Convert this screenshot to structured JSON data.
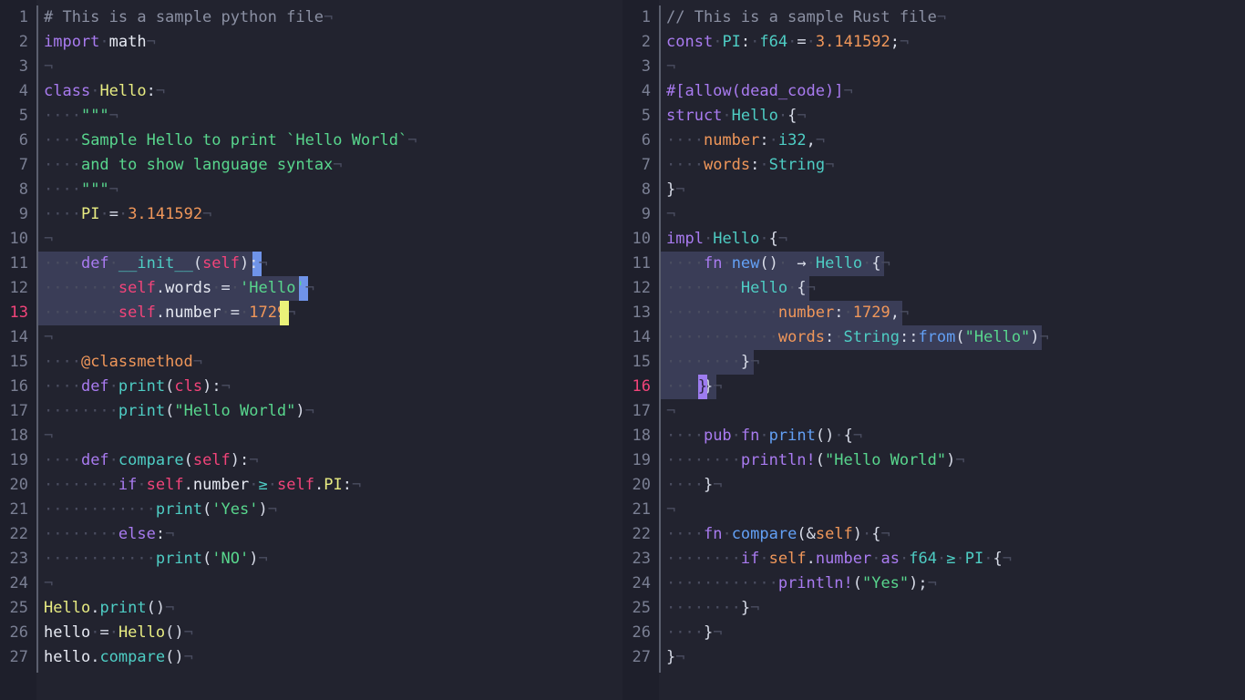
{
  "app": {
    "kind": "code-editor",
    "theme": "dark",
    "background": "#22232f",
    "gutter_background": "#1e1f2b",
    "gutter_separator": "#5b5f6e",
    "selection": "#3a3d57",
    "active_line_number": "#f2447a",
    "line_number": "#7a7f93",
    "whitespace_marker": "·",
    "eol_marker": "¬"
  },
  "panes": [
    {
      "name": "python-pane",
      "language": "python",
      "active_line": 13,
      "caret_color": "#eaf279",
      "eol_select_color": "#6f93e8",
      "first_line": 1,
      "last_line": 27,
      "lines": [
        {
          "n": 1,
          "text": "# This is a sample python file"
        },
        {
          "n": 2,
          "text": "import math"
        },
        {
          "n": 3,
          "text": ""
        },
        {
          "n": 4,
          "text": "class Hello:"
        },
        {
          "n": 5,
          "text": "    \"\"\""
        },
        {
          "n": 6,
          "text": "    Sample Hello to print `Hello World`"
        },
        {
          "n": 7,
          "text": "    and to show language syntax"
        },
        {
          "n": 8,
          "text": "    \"\"\""
        },
        {
          "n": 9,
          "text": "    PI = 3.141592"
        },
        {
          "n": 10,
          "text": ""
        },
        {
          "n": 11,
          "text": "    def __init__(self):"
        },
        {
          "n": 12,
          "text": "        self.words = 'Hello'"
        },
        {
          "n": 13,
          "text": "        self.number = 1729"
        },
        {
          "n": 14,
          "text": ""
        },
        {
          "n": 15,
          "text": "    @classmethod"
        },
        {
          "n": 16,
          "text": "    def print(cls):"
        },
        {
          "n": 17,
          "text": "        print(\"Hello World\")"
        },
        {
          "n": 18,
          "text": ""
        },
        {
          "n": 19,
          "text": "    def compare(self):"
        },
        {
          "n": 20,
          "text": "        if self.number >= self.PI:"
        },
        {
          "n": 21,
          "text": "            print('Yes')"
        },
        {
          "n": 22,
          "text": "        else:"
        },
        {
          "n": 23,
          "text": "            print('NO')"
        },
        {
          "n": 24,
          "text": ""
        },
        {
          "n": 25,
          "text": "Hello.print()"
        },
        {
          "n": 26,
          "text": "hello = Hello()"
        },
        {
          "n": 27,
          "text": "hello.compare()"
        }
      ],
      "selected_lines": [
        11,
        12,
        13
      ]
    },
    {
      "name": "rust-pane",
      "language": "rust",
      "active_line": 16,
      "caret_color": "#9d7cf0",
      "first_line": 1,
      "last_line": 27,
      "lines": [
        {
          "n": 1,
          "text": "// This is a sample Rust file"
        },
        {
          "n": 2,
          "text": "const PI: f64 = 3.141592;"
        },
        {
          "n": 3,
          "text": ""
        },
        {
          "n": 4,
          "text": "#[allow(dead_code)]"
        },
        {
          "n": 5,
          "text": "struct Hello {"
        },
        {
          "n": 6,
          "text": "    number: i32,"
        },
        {
          "n": 7,
          "text": "    words: String"
        },
        {
          "n": 8,
          "text": "}"
        },
        {
          "n": 9,
          "text": ""
        },
        {
          "n": 10,
          "text": "impl Hello {"
        },
        {
          "n": 11,
          "text": "    fn new() -> Hello {"
        },
        {
          "n": 12,
          "text": "        Hello {"
        },
        {
          "n": 13,
          "text": "            number: 1729,"
        },
        {
          "n": 14,
          "text": "            words: String::from(\"Hello\")"
        },
        {
          "n": 15,
          "text": "        }"
        },
        {
          "n": 16,
          "text": "    }"
        },
        {
          "n": 17,
          "text": ""
        },
        {
          "n": 18,
          "text": "    pub fn print() {"
        },
        {
          "n": 19,
          "text": "        println!(\"Hello World\")"
        },
        {
          "n": 20,
          "text": "    }"
        },
        {
          "n": 21,
          "text": ""
        },
        {
          "n": 22,
          "text": "    fn compare(&self) {"
        },
        {
          "n": 23,
          "text": "        if self.number as f64 >= PI {"
        },
        {
          "n": 24,
          "text": "            println!(\"Yes\");"
        },
        {
          "n": 25,
          "text": "        }"
        },
        {
          "n": 26,
          "text": "    }"
        },
        {
          "n": 27,
          "text": "}"
        }
      ],
      "selected_lines": [
        11,
        12,
        13,
        14,
        15,
        16
      ]
    }
  ],
  "ligatures": {
    "gte": "≥",
    "arrow_right": "→"
  }
}
